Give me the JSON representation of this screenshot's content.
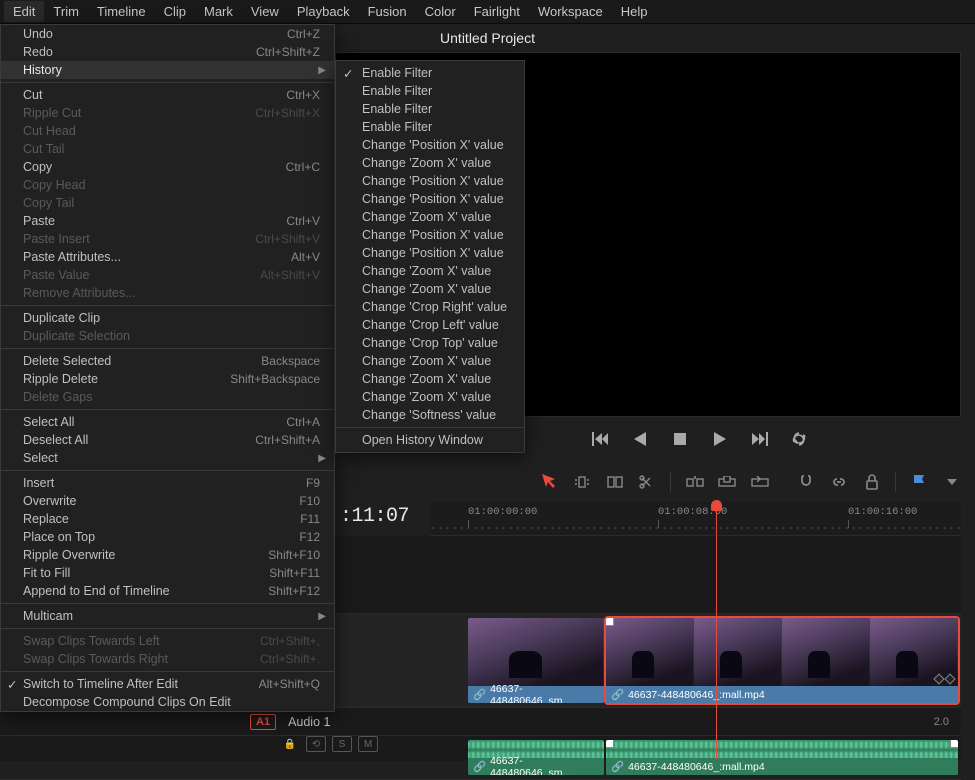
{
  "menubar": [
    "Edit",
    "Trim",
    "Timeline",
    "Clip",
    "Mark",
    "View",
    "Playback",
    "Fusion",
    "Color",
    "Fairlight",
    "Workspace",
    "Help"
  ],
  "projectTitle": "Untitled Project",
  "editMenu": {
    "groups": [
      [
        {
          "label": "Undo",
          "shortcut": "Ctrl+Z",
          "disabled": false
        },
        {
          "label": "Redo",
          "shortcut": "Ctrl+Shift+Z",
          "disabled": false
        },
        {
          "label": "History",
          "shortcut": "",
          "submenu": true,
          "hovered": true
        }
      ],
      [
        {
          "label": "Cut",
          "shortcut": "Ctrl+X",
          "disabled": false
        },
        {
          "label": "Ripple Cut",
          "shortcut": "Ctrl+Shift+X",
          "disabled": true
        },
        {
          "label": "Cut Head",
          "shortcut": "",
          "disabled": true
        },
        {
          "label": "Cut Tail",
          "shortcut": "",
          "disabled": true
        },
        {
          "label": "Copy",
          "shortcut": "Ctrl+C",
          "disabled": false
        },
        {
          "label": "Copy Head",
          "shortcut": "",
          "disabled": true
        },
        {
          "label": "Copy Tail",
          "shortcut": "",
          "disabled": true
        },
        {
          "label": "Paste",
          "shortcut": "Ctrl+V",
          "disabled": false
        },
        {
          "label": "Paste Insert",
          "shortcut": "Ctrl+Shift+V",
          "disabled": true
        },
        {
          "label": "Paste Attributes...",
          "shortcut": "Alt+V",
          "disabled": false
        },
        {
          "label": "Paste Value",
          "shortcut": "Alt+Shift+V",
          "disabled": true
        },
        {
          "label": "Remove Attributes...",
          "shortcut": "",
          "disabled": true
        }
      ],
      [
        {
          "label": "Duplicate Clip",
          "shortcut": "",
          "disabled": false
        },
        {
          "label": "Duplicate Selection",
          "shortcut": "",
          "disabled": true
        }
      ],
      [
        {
          "label": "Delete Selected",
          "shortcut": "Backspace",
          "disabled": false
        },
        {
          "label": "Ripple Delete",
          "shortcut": "Shift+Backspace",
          "disabled": false
        },
        {
          "label": "Delete Gaps",
          "shortcut": "",
          "disabled": true
        }
      ],
      [
        {
          "label": "Select All",
          "shortcut": "Ctrl+A",
          "disabled": false
        },
        {
          "label": "Deselect All",
          "shortcut": "Ctrl+Shift+A",
          "disabled": false
        },
        {
          "label": "Select",
          "shortcut": "",
          "submenu": true
        }
      ],
      [
        {
          "label": "Insert",
          "shortcut": "F9",
          "disabled": false
        },
        {
          "label": "Overwrite",
          "shortcut": "F10",
          "disabled": false
        },
        {
          "label": "Replace",
          "shortcut": "F11",
          "disabled": false
        },
        {
          "label": "Place on Top",
          "shortcut": "F12",
          "disabled": false
        },
        {
          "label": "Ripple Overwrite",
          "shortcut": "Shift+F10",
          "disabled": false
        },
        {
          "label": "Fit to Fill",
          "shortcut": "Shift+F11",
          "disabled": false
        },
        {
          "label": "Append to End of Timeline",
          "shortcut": "Shift+F12",
          "disabled": false
        }
      ],
      [
        {
          "label": "Multicam",
          "shortcut": "",
          "submenu": true
        }
      ],
      [
        {
          "label": "Swap Clips Towards Left",
          "shortcut": "Ctrl+Shift+,",
          "disabled": true
        },
        {
          "label": "Swap Clips Towards Right",
          "shortcut": "Ctrl+Shift+.",
          "disabled": true
        }
      ],
      [
        {
          "label": "Switch to Timeline After Edit",
          "shortcut": "Alt+Shift+Q",
          "checked": true
        },
        {
          "label": "Decompose Compound Clips On Edit",
          "shortcut": ""
        }
      ]
    ]
  },
  "historyMenu": {
    "items": [
      {
        "label": "Enable Filter",
        "checked": true
      },
      {
        "label": "Enable Filter"
      },
      {
        "label": "Enable Filter"
      },
      {
        "label": "Enable Filter"
      },
      {
        "label": "Change 'Position X' value"
      },
      {
        "label": "Change 'Zoom X' value"
      },
      {
        "label": "Change 'Position X' value"
      },
      {
        "label": "Change 'Position X' value"
      },
      {
        "label": "Change 'Zoom X' value"
      },
      {
        "label": "Change 'Position X' value"
      },
      {
        "label": "Change 'Position X' value"
      },
      {
        "label": "Change 'Zoom X' value"
      },
      {
        "label": "Change 'Zoom X' value"
      },
      {
        "label": "Change 'Crop Right' value"
      },
      {
        "label": "Change 'Crop Left' value"
      },
      {
        "label": "Change 'Crop Top' value"
      },
      {
        "label": "Change 'Zoom X' value"
      },
      {
        "label": "Change 'Zoom X' value"
      },
      {
        "label": "Change 'Zoom X' value"
      },
      {
        "label": "Change 'Softness' value"
      }
    ],
    "footer": "Open History Window"
  },
  "timecode": ":11:07",
  "ruler": [
    "01:00:00:00",
    "01:00:08:00",
    "01:00:16:00"
  ],
  "audioTrack": {
    "tag": "A1",
    "name": "Audio 1",
    "level": "2.0",
    "solo": "S",
    "mute": "M"
  },
  "clips": {
    "v1": "46637-448480646_sm…",
    "v2": "46637-448480646_:mall.mp4",
    "a1": "46637-448480646_sm…",
    "a2": "46637-448480646_:mall.mp4"
  }
}
